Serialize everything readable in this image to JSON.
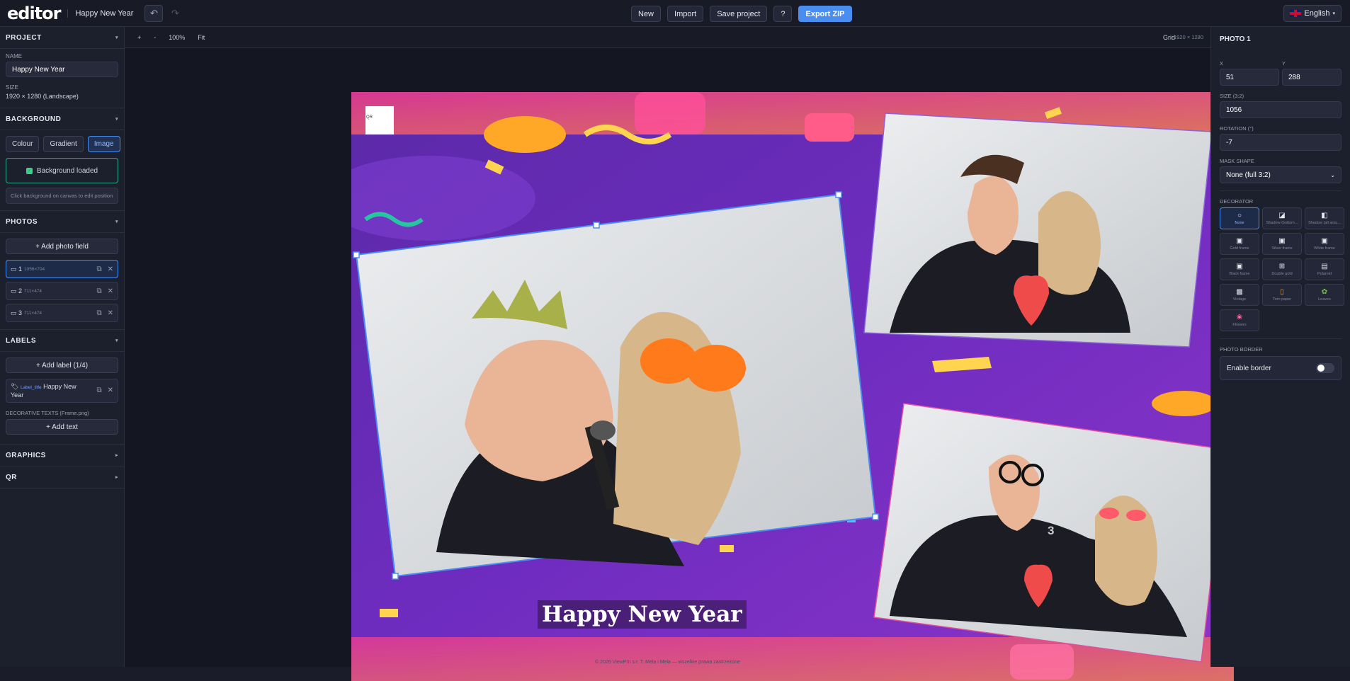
{
  "topbar": {
    "logo": "editor",
    "project_title": "Happy New Year",
    "undo": "↶",
    "redo": "↷",
    "buttons": {
      "new": "New",
      "import": "Import",
      "save": "Save project",
      "help": "?",
      "export": "Export ZIP"
    },
    "language": "English",
    "language_caret": "▾"
  },
  "left": {
    "project": {
      "header": "PROJECT",
      "name_label": "NAME",
      "name_value": "Happy New Year",
      "size_label": "SIZE",
      "size_value": "1920 × 1280 (Landscape)"
    },
    "background": {
      "header": "BACKGROUND",
      "tabs": [
        "Colour",
        "Gradient",
        "Image"
      ],
      "active_tab": "Image",
      "status": "Background loaded",
      "hint": "Click background on canvas to edit position"
    },
    "photos": {
      "header": "PHOTOS",
      "add": "+ Add photo field",
      "items": [
        {
          "num": "1",
          "dims": "1056×704"
        },
        {
          "num": "2",
          "dims": "711×474"
        },
        {
          "num": "3",
          "dims": "711×474"
        }
      ]
    },
    "labels": {
      "header": "LABELS",
      "add": "+ Add label (1/4)",
      "item_tag": "Label_title",
      "item_text": "Happy New Year"
    },
    "decorative": {
      "label": "DECORATIVE TEXTS (Frame.png)",
      "add": "+ Add text"
    },
    "graphics": {
      "header": "GRAPHICS"
    },
    "qr": {
      "header": "QR"
    },
    "caret": "▾",
    "caret_collapsed": "▸"
  },
  "canvas": {
    "zoom_in": "+",
    "zoom_out": "-",
    "zoom": "100%",
    "fit": "Fit",
    "grid": "Grid",
    "resolution": "1920 × 1280",
    "qr_label": "QR",
    "title_text": "Happy New Year",
    "photo3_number": "3",
    "footer": "© 2026 ViewPrn s.r. T. Mela i Mela — wszelkie prawa zastrzeżone"
  },
  "right": {
    "header": "PHOTO 1",
    "x_label": "X",
    "x_value": "51",
    "y_label": "Y",
    "y_value": "288",
    "size_label": "SIZE (3:2)",
    "size_value": "1056",
    "rotation_label": "ROTATION (°)",
    "rotation_value": "-7",
    "mask_label": "MASK SHAPE",
    "mask_value": "None (full 3:2)",
    "decorator_label": "DECORATOR",
    "decorators": [
      {
        "name": "None",
        "icon": "○"
      },
      {
        "name": "Shadow (bottom...",
        "icon": "◪"
      },
      {
        "name": "Shadow (all arou...",
        "icon": "◧"
      },
      {
        "name": "Gold frame",
        "icon": "▣"
      },
      {
        "name": "Silver frame",
        "icon": "▣"
      },
      {
        "name": "White frame",
        "icon": "▣"
      },
      {
        "name": "Black frame",
        "icon": "▣"
      },
      {
        "name": "Double gold",
        "icon": "⊞"
      },
      {
        "name": "Polaroid",
        "icon": "▤"
      },
      {
        "name": "Vintage",
        "icon": "▩"
      },
      {
        "name": "Torn paper",
        "icon": "▯"
      },
      {
        "name": "Leaves",
        "icon": "✿"
      },
      {
        "name": "Flowers",
        "icon": "❀"
      }
    ],
    "border_label": "PHOTO BORDER",
    "border_toggle": "Enable border"
  },
  "colors": {
    "accent": "#4a8df0",
    "success": "#2fa88b",
    "bg_purple": "#6a2bb8"
  }
}
